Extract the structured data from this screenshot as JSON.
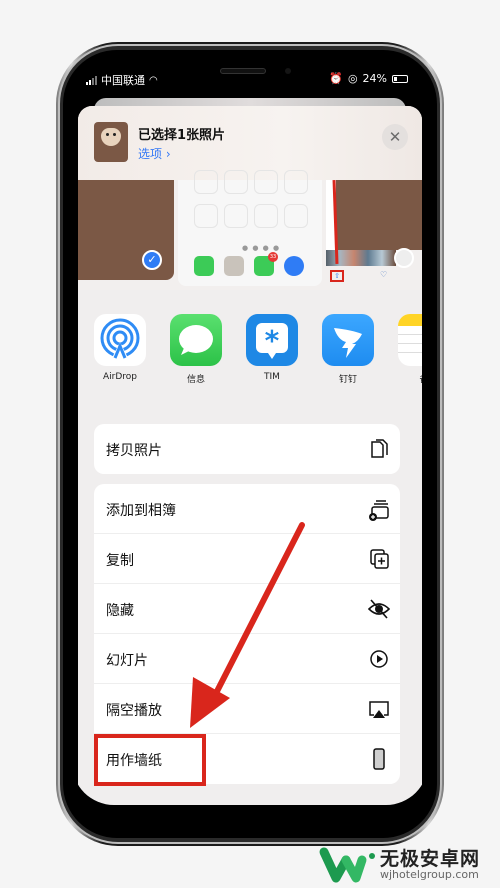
{
  "status_bar": {
    "carrier": "中国联通",
    "battery": "24%"
  },
  "share_sheet": {
    "title": "已选择1张照片",
    "options_link": "选项 ›",
    "close_label": "✕",
    "preview": {
      "selected_check": "✓",
      "messages_badge": "33"
    },
    "apps": [
      {
        "label": "AirDrop",
        "icon": "airdrop-icon"
      },
      {
        "label": "信息",
        "icon": "messages-icon"
      },
      {
        "label": "TIM",
        "icon": "tim-icon"
      },
      {
        "label": "钉钉",
        "icon": "dingtalk-icon"
      },
      {
        "label": "备",
        "icon": "notes-icon"
      }
    ],
    "group1": [
      {
        "label": "拷贝照片",
        "icon": "copy-photo-icon"
      }
    ],
    "group2": [
      {
        "label": "添加到相簿",
        "icon": "add-to-album-icon"
      },
      {
        "label": "复制",
        "icon": "duplicate-icon"
      },
      {
        "label": "隐藏",
        "icon": "hide-icon"
      },
      {
        "label": "幻灯片",
        "icon": "slideshow-icon"
      },
      {
        "label": "隔空播放",
        "icon": "airplay-icon"
      },
      {
        "label": "用作墙纸",
        "icon": "wallpaper-icon"
      }
    ]
  },
  "annotation": {
    "color": "#d9261c"
  },
  "watermark": {
    "name": "无极安卓网",
    "url": "wjhotelgroup.com"
  }
}
